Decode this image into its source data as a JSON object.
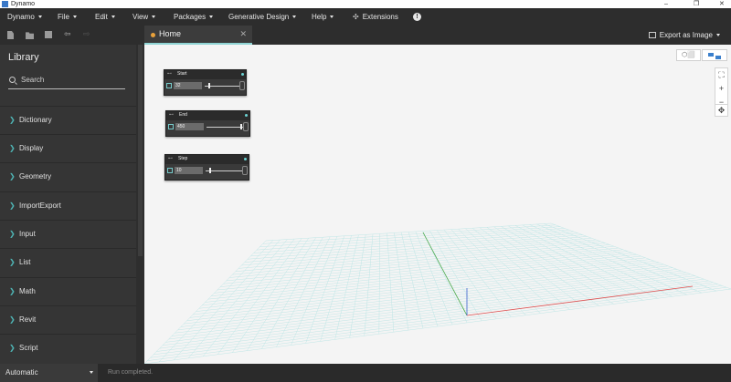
{
  "window": {
    "title": "Dynamo",
    "controls": [
      "–",
      "❐",
      "✕"
    ]
  },
  "menu": {
    "items": [
      {
        "label": "Dynamo",
        "caret": true
      },
      {
        "label": "File",
        "caret": true
      },
      {
        "label": "Edit",
        "caret": true
      },
      {
        "label": "View",
        "caret": true
      },
      {
        "label": "Packages",
        "caret": true
      },
      {
        "label": "Generative Design",
        "caret": true
      },
      {
        "label": "Help",
        "caret": true
      },
      {
        "label": "Extensions",
        "caret": false
      }
    ],
    "extensions_icon": "puzzle-icon",
    "info_icon": "!"
  },
  "toolbar": {
    "icons": [
      "new-file-icon",
      "open-folder-icon",
      "save-icon",
      "undo-icon",
      "redo-icon"
    ],
    "undo_glyph": "⇦",
    "redo_glyph": "⇨"
  },
  "tabs": [
    {
      "label": "Home",
      "close": "✕",
      "modified_color": "#e8a13a"
    }
  ],
  "export": {
    "label": "Export as Image"
  },
  "library": {
    "title": "Library",
    "search_placeholder": "Search",
    "chevron": "❯",
    "items": [
      "Dictionary",
      "Display",
      "Geometry",
      "ImportExport",
      "Input",
      "List",
      "Math",
      "Revit",
      "Script"
    ]
  },
  "nodes": [
    {
      "title": "Start",
      "value": "32"
    },
    {
      "title": "End",
      "value": "450"
    },
    {
      "title": "Step",
      "value": "10"
    }
  ],
  "canvas_controls": {
    "fit_glyph": "⛶",
    "zoom_in": "+",
    "zoom_out": "−",
    "pan_glyph": "✥"
  },
  "status": {
    "run_mode": "Automatic",
    "message": "Run completed."
  },
  "colors": {
    "accent_teal": "#8fd4d4",
    "grid_line": "#bfe6e6",
    "x_axis": "#e05050",
    "y_axis": "#4aa84a",
    "z_axis": "#3a5fcc"
  }
}
